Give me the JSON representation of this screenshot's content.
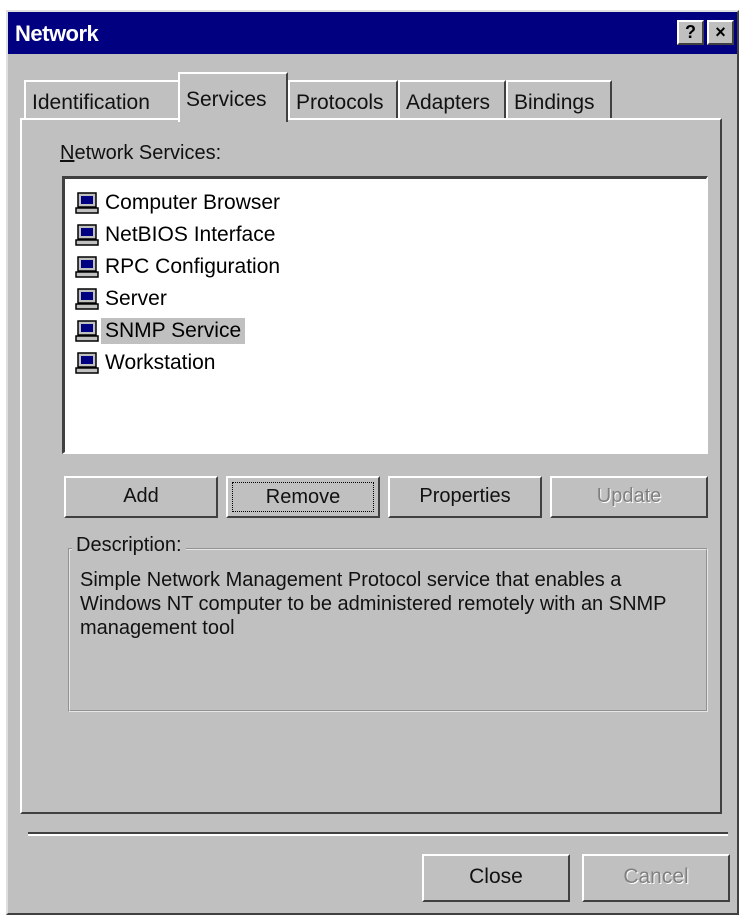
{
  "window": {
    "title": "Network",
    "help_button": "?",
    "close_button": "×"
  },
  "tabs": [
    {
      "label": "Identification",
      "active": false
    },
    {
      "label": "Services",
      "active": true
    },
    {
      "label": "Protocols",
      "active": false
    },
    {
      "label": "Adapters",
      "active": false
    },
    {
      "label": "Bindings",
      "active": false
    }
  ],
  "services_panel": {
    "list_label_accel": "N",
    "list_label_rest": "etwork Services:",
    "items": [
      {
        "label": "Computer Browser",
        "icon": "computer-icon",
        "selected": false
      },
      {
        "label": "NetBIOS Interface",
        "icon": "computer-icon",
        "selected": false
      },
      {
        "label": "RPC Configuration",
        "icon": "computer-icon",
        "selected": false
      },
      {
        "label": "Server",
        "icon": "computer-icon",
        "selected": false
      },
      {
        "label": "SNMP Service",
        "icon": "computer-icon",
        "selected": true
      },
      {
        "label": "Workstation",
        "icon": "computer-icon",
        "selected": false
      }
    ],
    "buttons": {
      "add": "Add",
      "remove": "Remove",
      "properties": "Properties",
      "update": "Update"
    },
    "description_label": "Description:",
    "description_text": "Simple Network Management Protocol service that enables a Windows NT computer to be administered remotely with an SNMP management tool"
  },
  "footer": {
    "close": "Close",
    "cancel": "Cancel"
  },
  "colors": {
    "titlebar": "#000080",
    "face": "#c0c0c0"
  }
}
